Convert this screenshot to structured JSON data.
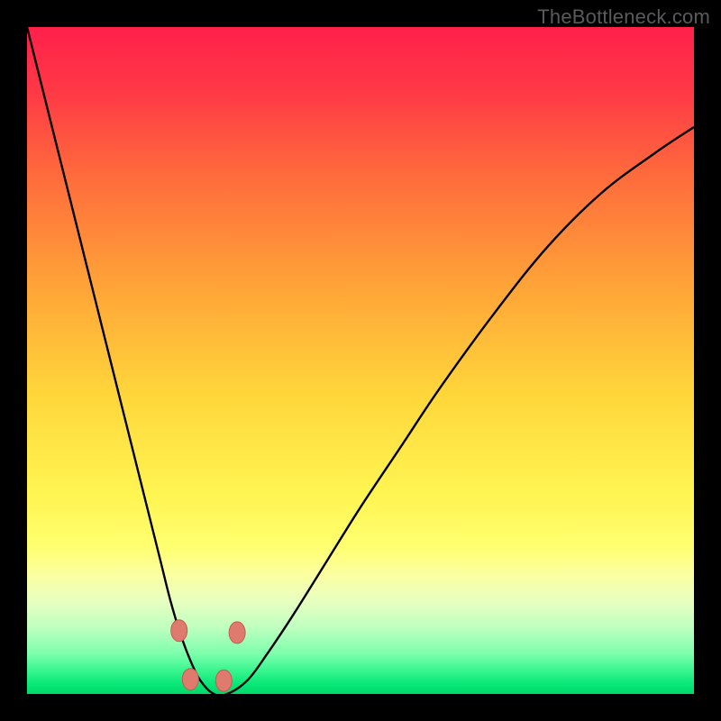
{
  "watermark": {
    "text": "TheBottleneck.com"
  },
  "colors": {
    "black": "#000000",
    "curve": "#000000",
    "marker_fill": "#df7a6f",
    "marker_stroke": "#c85a50",
    "gradient_stops": [
      {
        "offset": 0.0,
        "color": "#ff204a"
      },
      {
        "offset": 0.1,
        "color": "#ff3a46"
      },
      {
        "offset": 0.22,
        "color": "#ff6a3c"
      },
      {
        "offset": 0.38,
        "color": "#ffa138"
      },
      {
        "offset": 0.55,
        "color": "#ffd63a"
      },
      {
        "offset": 0.7,
        "color": "#fff552"
      },
      {
        "offset": 0.78,
        "color": "#ffff70"
      },
      {
        "offset": 0.82,
        "color": "#fbffa0"
      },
      {
        "offset": 0.86,
        "color": "#e8ffc0"
      },
      {
        "offset": 0.9,
        "color": "#bfffc0"
      },
      {
        "offset": 0.94,
        "color": "#7cffac"
      },
      {
        "offset": 0.965,
        "color": "#38f58e"
      },
      {
        "offset": 0.985,
        "color": "#08e878"
      },
      {
        "offset": 1.0,
        "color": "#00d868"
      }
    ]
  },
  "chart_data": {
    "type": "line",
    "title": "",
    "xlabel": "",
    "ylabel": "",
    "x": [
      0.0,
      0.02,
      0.04,
      0.06,
      0.08,
      0.1,
      0.12,
      0.14,
      0.16,
      0.18,
      0.2,
      0.215,
      0.23,
      0.245,
      0.26,
      0.28,
      0.3,
      0.33,
      0.36,
      0.4,
      0.45,
      0.5,
      0.56,
      0.62,
      0.7,
      0.78,
      0.86,
      0.94,
      1.0
    ],
    "values": [
      1.0,
      0.92,
      0.84,
      0.76,
      0.68,
      0.6,
      0.52,
      0.44,
      0.36,
      0.28,
      0.2,
      0.14,
      0.09,
      0.05,
      0.02,
      0.0,
      0.0,
      0.02,
      0.06,
      0.12,
      0.2,
      0.28,
      0.37,
      0.46,
      0.57,
      0.67,
      0.75,
      0.81,
      0.85
    ],
    "xlim": [
      0,
      1
    ],
    "ylim": [
      0,
      1
    ],
    "minimum_x": 0.27,
    "markers": [
      {
        "x": 0.228,
        "y": 0.095
      },
      {
        "x": 0.245,
        "y": 0.022
      },
      {
        "x": 0.295,
        "y": 0.02
      },
      {
        "x": 0.315,
        "y": 0.092
      }
    ],
    "marker_rx": 9,
    "marker_ry": 12
  }
}
